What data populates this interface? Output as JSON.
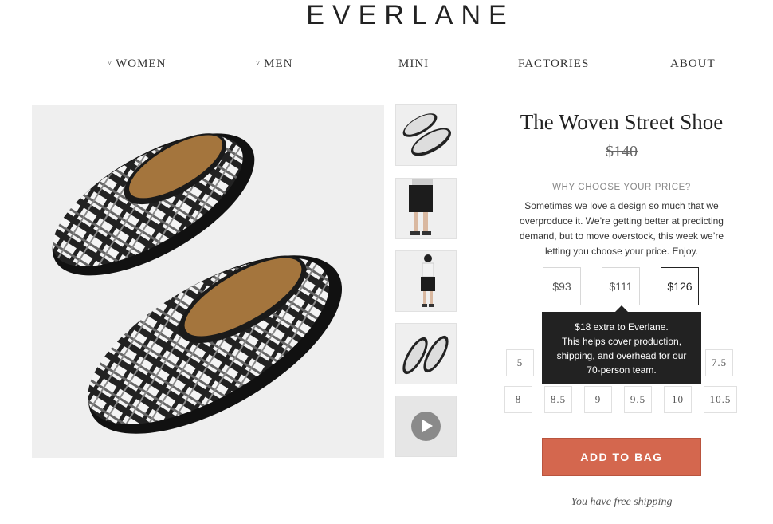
{
  "brand": {
    "logo": "EVERLANE"
  },
  "nav": {
    "items": [
      {
        "label": "WOMEN",
        "has_dropdown": true
      },
      {
        "label": "MEN",
        "has_dropdown": true
      },
      {
        "label": "MINI",
        "has_dropdown": false
      },
      {
        "label": "FACTORIES",
        "has_dropdown": false
      },
      {
        "label": "ABOUT",
        "has_dropdown": false
      }
    ],
    "chevron": "˅"
  },
  "product": {
    "title": "The Woven Street Shoe",
    "original_price": "$140",
    "why_heading": "WHY CHOOSE YOUR PRICE?",
    "description": "Sometimes we love a design so much that we overproduce it. We’re getting better at predicting demand, but to move overstock, this week we’re letting you choose your price. Enjoy.",
    "price_options": [
      {
        "label": "$93",
        "selected": false
      },
      {
        "label": "$111",
        "selected": false
      },
      {
        "label": "$126",
        "selected": true
      }
    ],
    "tooltip": {
      "line1": "$18 extra to Everlane.",
      "line2": "This helps cover production, shipping, and overhead for our 70-person team."
    },
    "sizes_row1": [
      "5",
      "7.5"
    ],
    "sizes_row2": [
      "8",
      "8.5",
      "9",
      "9.5",
      "10",
      "10.5"
    ],
    "add_to_bag": "ADD TO BAG",
    "shipping_note": "You have free shipping"
  },
  "gallery": {
    "thumbnails": [
      "shoe-pair-thumbnail",
      "model-shorts-thumbnail",
      "model-full-body-thumbnail",
      "shoe-top-view-thumbnail",
      "video-thumbnail"
    ],
    "play_icon": "play-icon"
  },
  "colors": {
    "accent": "#d4674e",
    "tooltip_bg": "#222222",
    "image_bg": "#efefef"
  }
}
